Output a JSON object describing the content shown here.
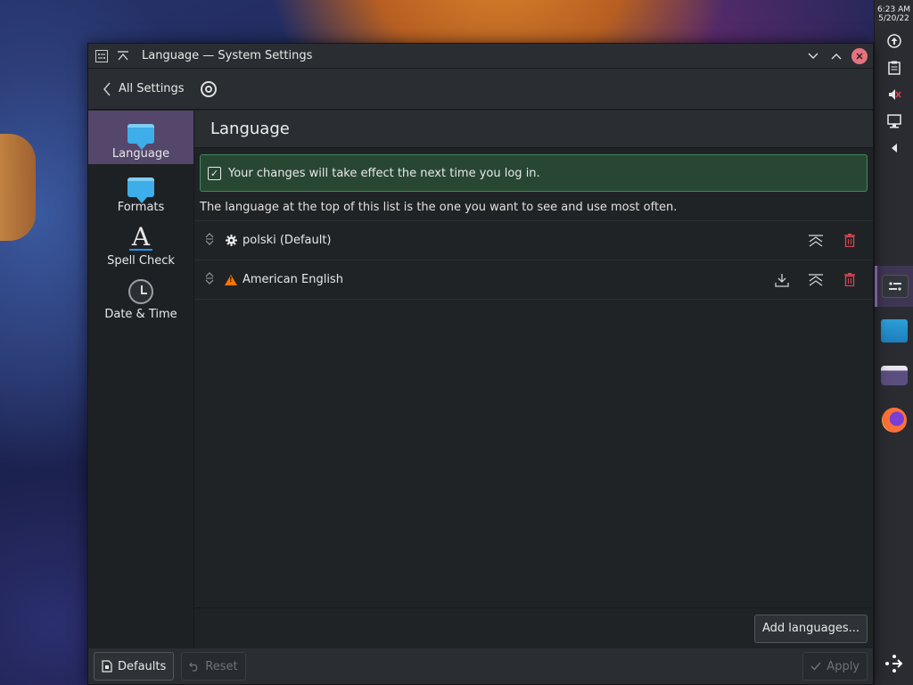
{
  "window": {
    "title": "Language — System Settings"
  },
  "nav": {
    "back_label": "All Settings"
  },
  "sidebar": {
    "items": [
      {
        "label": "Language"
      },
      {
        "label": "Formats"
      },
      {
        "label": "Spell Check"
      },
      {
        "label": "Date & Time"
      }
    ]
  },
  "page": {
    "title": "Language",
    "notice": "Your changes will take effect the next time you log in.",
    "description": "The language at the top of this list is the one you want to see and use most often."
  },
  "languages": [
    {
      "name": "polski (Default)",
      "icon": "gear-icon"
    },
    {
      "name": "American English",
      "icon": "warning-icon"
    }
  ],
  "buttons": {
    "add_languages": "Add languages...",
    "defaults": "Defaults",
    "reset": "Reset",
    "apply": "Apply"
  },
  "clock": {
    "time": "6:23 AM",
    "date": "5/20/22"
  },
  "colors": {
    "accent": "#3daee9",
    "sidebar_active": "#54476b",
    "notice_bg": "#284733",
    "delete": "#da4453"
  }
}
